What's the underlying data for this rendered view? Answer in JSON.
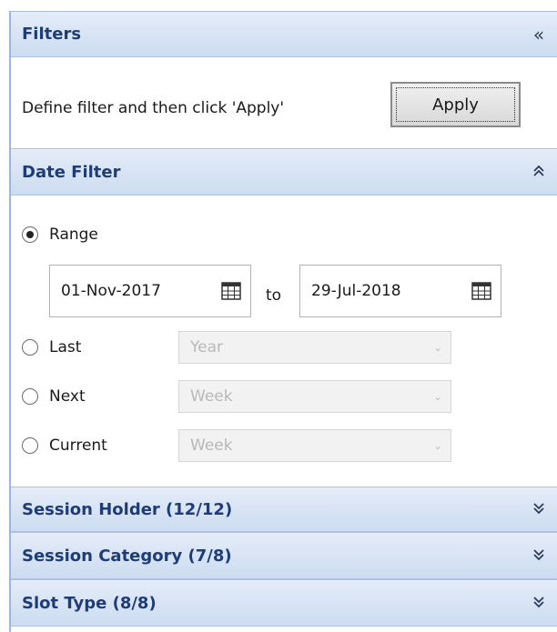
{
  "filters": {
    "title": "Filters",
    "collapse_glyph": "«",
    "instruction": "Define filter and then click 'Apply'",
    "apply_label": "Apply"
  },
  "date_filter": {
    "title": "Date Filter",
    "range_label": "Range",
    "range_selected": true,
    "from_date": "01-Nov-2017",
    "to_label": "to",
    "to_date": "29-Jul-2018",
    "last_label": "Last",
    "last_value": "Year",
    "next_label": "Next",
    "next_value": "Week",
    "current_label": "Current",
    "current_value": "Week"
  },
  "sections": {
    "session_holder": "Session Holder (12/12)",
    "session_category": "Session Category (7/8)",
    "slot_type": "Slot Type (8/8)"
  },
  "icons": {
    "collapse_all": "double-chevron-left-icon",
    "section_expanded": "double-chevron-up-icon",
    "section_collapsed": "double-chevron-down-icon",
    "calendar": "calendar-icon"
  },
  "colors": {
    "header_text": "#1e3d78",
    "header_bg": "#d6e2f4",
    "panel_border": "#9db6dd"
  }
}
